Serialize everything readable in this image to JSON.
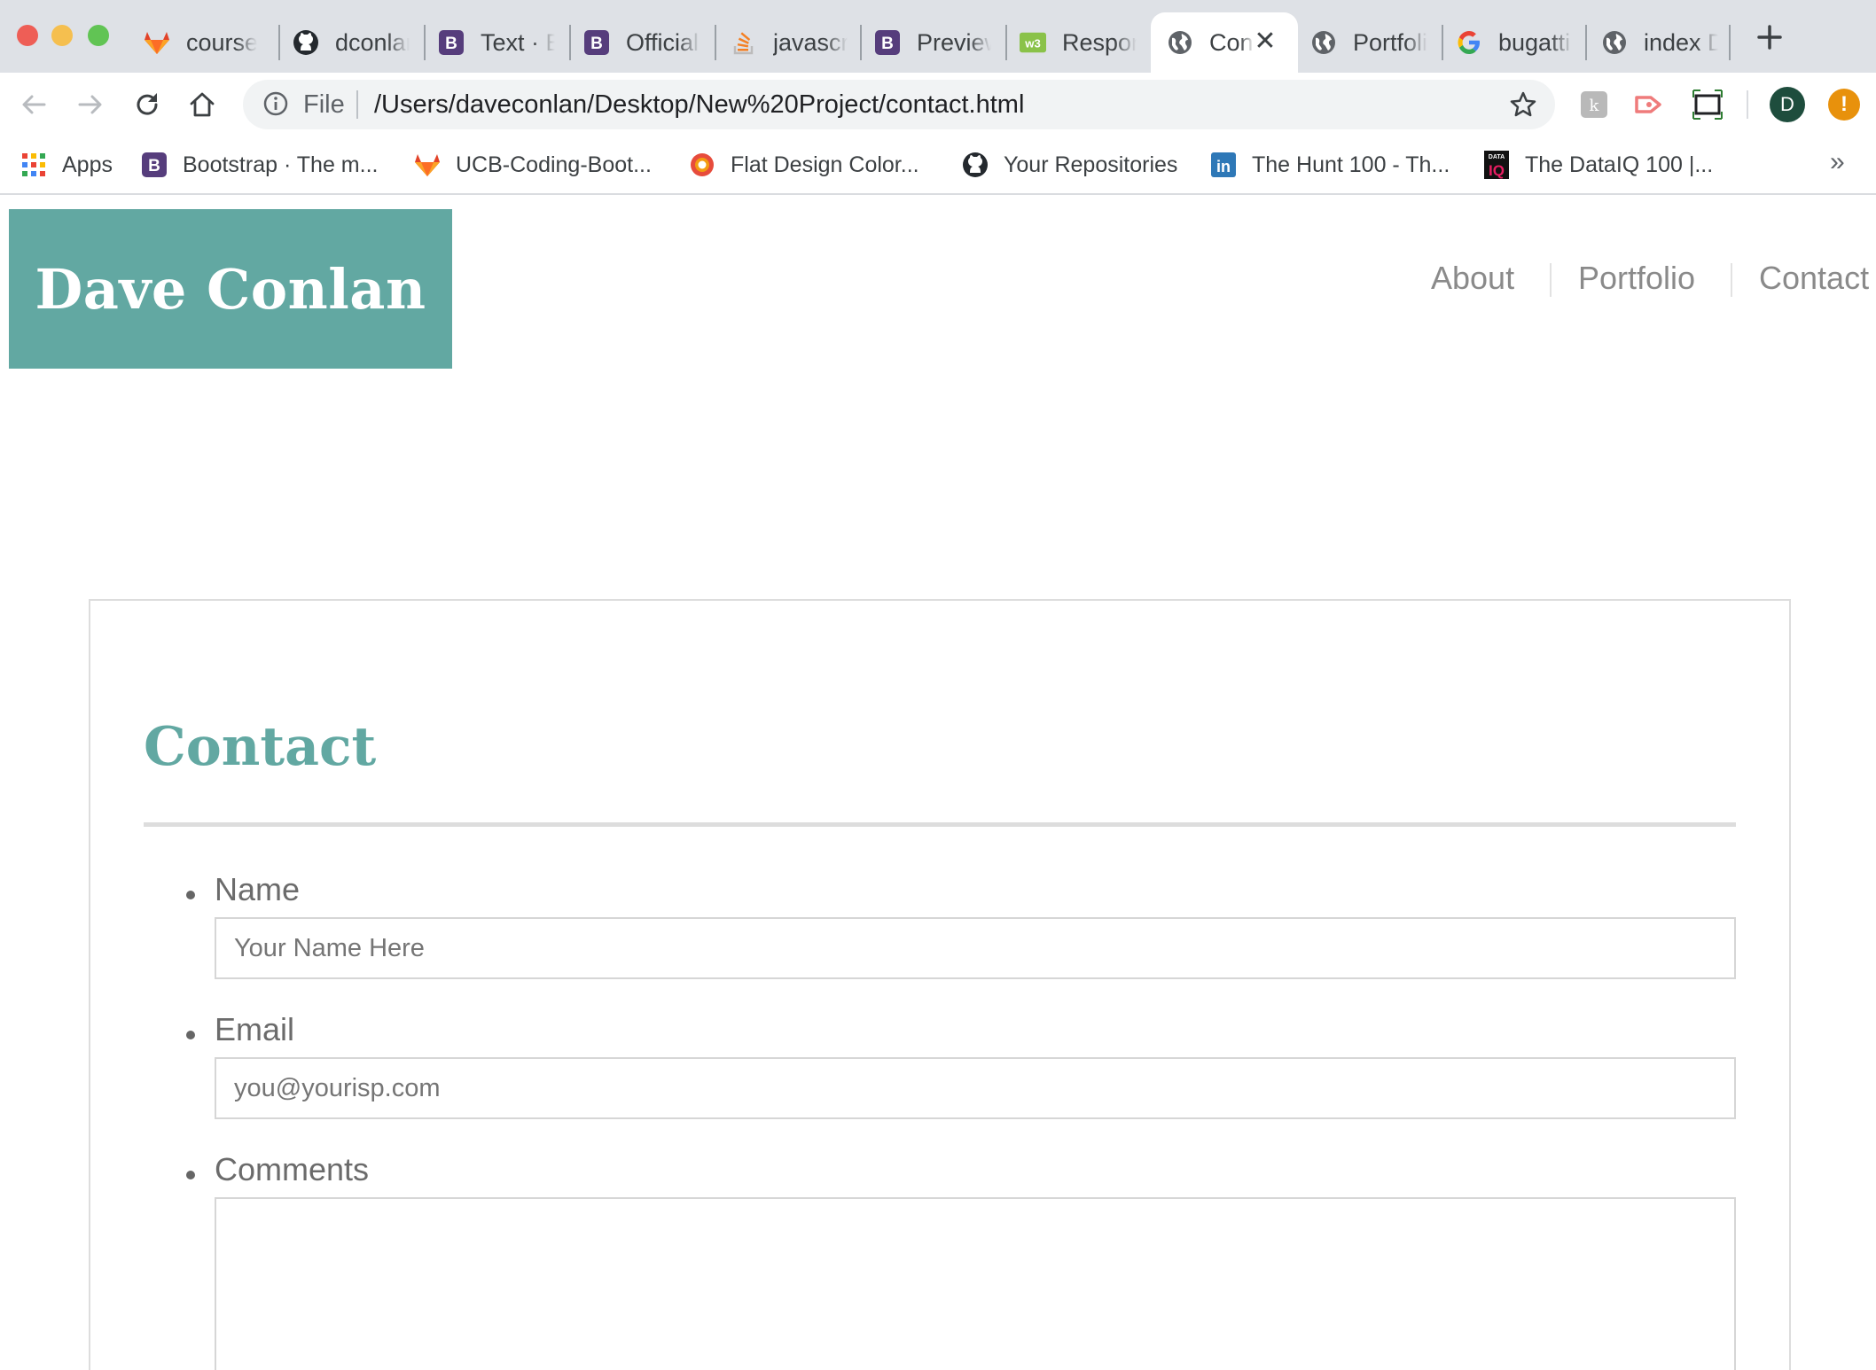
{
  "browser": {
    "tabs": [
      {
        "title": "course-",
        "icon": "gitlab-icon"
      },
      {
        "title": "dconlan",
        "icon": "github-icon"
      },
      {
        "title": "Text · B",
        "icon": "bootstrap-icon"
      },
      {
        "title": "Official",
        "icon": "bootstrap-icon"
      },
      {
        "title": "javascri",
        "icon": "stackoverflow-icon"
      },
      {
        "title": "Preview",
        "icon": "bootstrap-icon"
      },
      {
        "title": "Respon",
        "icon": "w3schools-icon"
      },
      {
        "title": "Con",
        "icon": "globe-icon",
        "active": true
      },
      {
        "title": "Portfoli",
        "icon": "globe-icon"
      },
      {
        "title": "bugatti",
        "icon": "google-icon"
      },
      {
        "title": "index D",
        "icon": "globe-icon"
      }
    ],
    "address": {
      "scheme_label": "File",
      "url": "/Users/daveconlan/Desktop/New%20Project/contact.html"
    },
    "profile_initial": "D",
    "alert_glyph": "!",
    "bookmarks": [
      {
        "label": "Apps",
        "icon": "apps-grid-icon"
      },
      {
        "label": "Bootstrap · The m...",
        "icon": "bootstrap-icon"
      },
      {
        "label": "UCB-Coding-Boot...",
        "icon": "gitlab-icon"
      },
      {
        "label": "Flat Design Color...",
        "icon": "flat-design-icon"
      },
      {
        "label": "Your Repositories",
        "icon": "github-icon"
      },
      {
        "label": "The Hunt 100 - Th...",
        "icon": "linkedin-icon"
      },
      {
        "label": "The DataIQ 100 |...",
        "icon": "dataiq-icon"
      }
    ],
    "bookmarks_overflow": "»",
    "colors": {
      "tabstrip": "#dee1e6",
      "omnibox": "#f1f3f4"
    }
  },
  "site": {
    "brand": "Dave Conlan",
    "nav": [
      "About",
      "Portfolio",
      "Contact"
    ],
    "accent_color": "#62a8a2"
  },
  "contact": {
    "title": "Contact",
    "fields": {
      "name": {
        "label": "Name",
        "placeholder": "Your Name Here"
      },
      "email": {
        "label": "Email",
        "placeholder": "you@yourisp.com"
      },
      "comments": {
        "label": "Comments"
      }
    }
  }
}
